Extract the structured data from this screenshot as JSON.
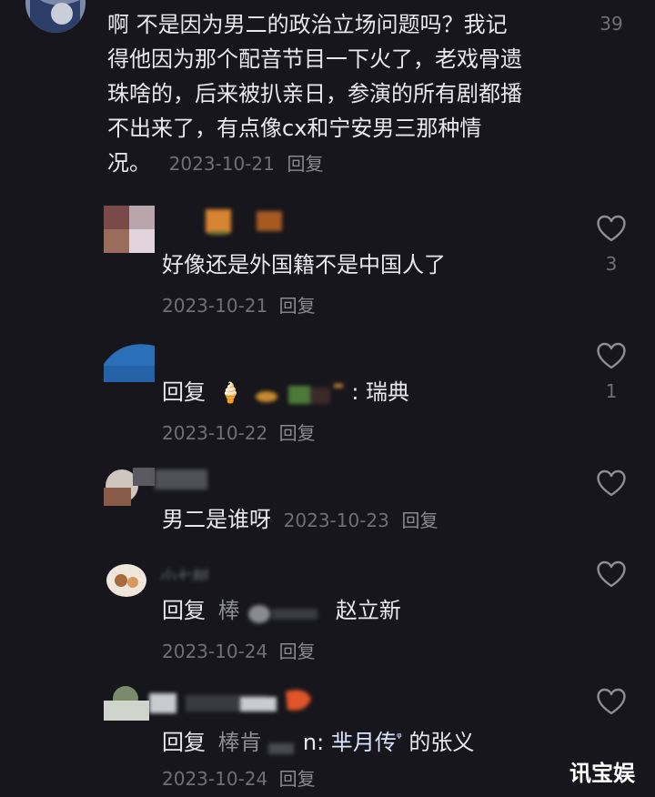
{
  "comments": [
    {
      "text_lines": [
        "啊  不是因为男二的政治立场问题吗？我记",
        "得他因为那个配音节目一下火了，老戏骨遗",
        "珠啥的，后来被扒亲日，参演的所有剧都播",
        "不出来了，有点像cx和宁安男三那种情",
        "况。"
      ],
      "date": "2023-10-21",
      "reply_label": "回复",
      "like_count": "39"
    },
    {
      "text": "好像还是外国籍不是中国人了",
      "date": "2023-10-21",
      "reply_label": "回复",
      "like_count": "3"
    },
    {
      "prefix": "回复",
      "emoji": "🍦",
      "suffix": ": 瑞典",
      "date": "2023-10-22",
      "reply_label": "回复",
      "like_count": "1"
    },
    {
      "text": "男二是谁呀",
      "date": "2023-10-23",
      "reply_label": "回复"
    },
    {
      "username_fragment": "小七树",
      "prefix": "回复",
      "mention": "棒",
      "suffix": "赵立新",
      "date": "2023-10-24",
      "reply_label": "回复"
    },
    {
      "prefix": "回复",
      "mention": "棒肯",
      "mention_tail": "n:",
      "highlight": "芈月传",
      "search_glyph": "ᵠ",
      "suffix": "的张义",
      "date": "2023-10-24",
      "reply_label": "回复"
    }
  ],
  "watermark": "讯宝娱",
  "colors": {
    "background": "#16161c",
    "text": "#e9e9ec",
    "meta": "#6f6f78",
    "highlight": "#ffffff"
  },
  "icons": [
    "heart-outline-icon"
  ]
}
